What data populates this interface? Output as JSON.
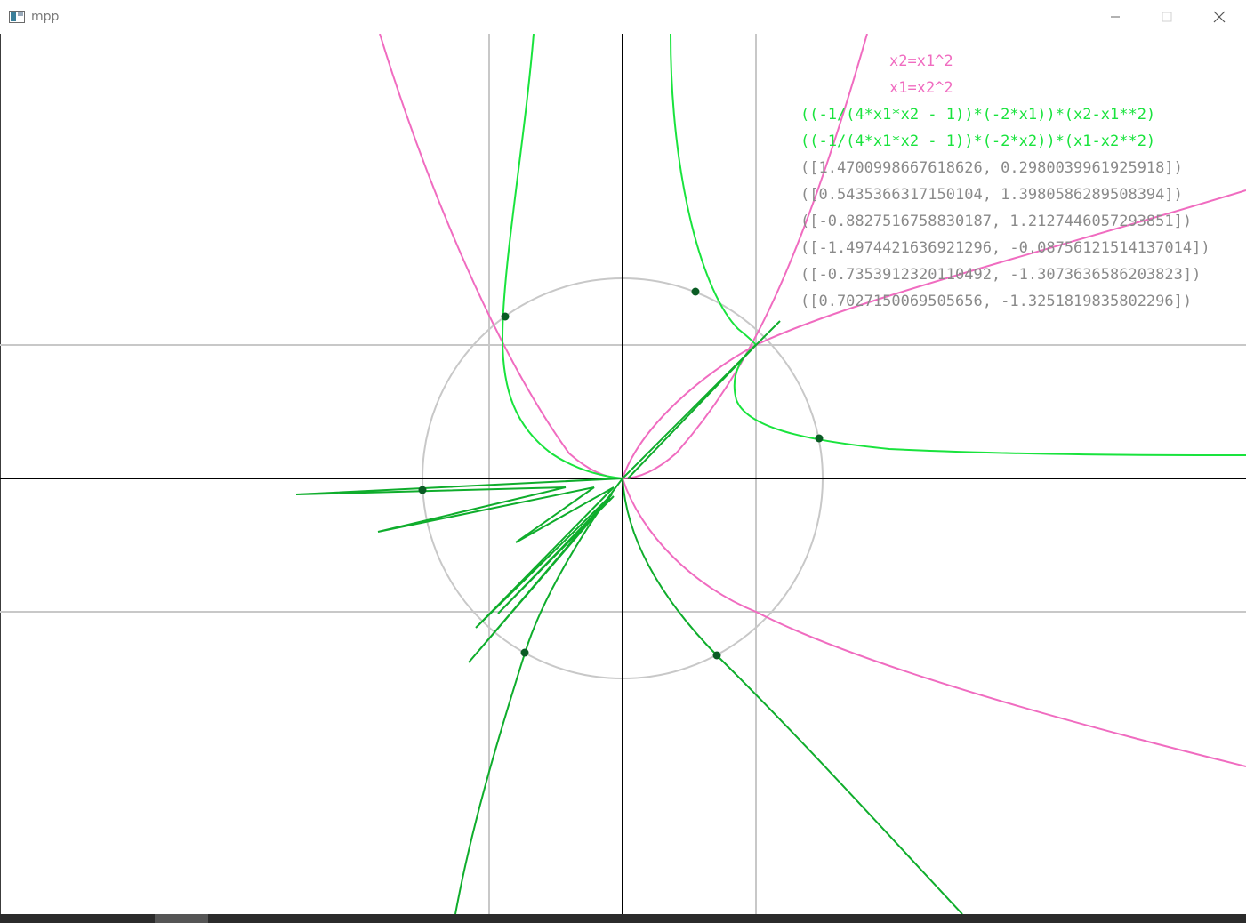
{
  "window": {
    "title": "mpp",
    "icon": "app-window-icon",
    "controls": {
      "minimize_icon": "minimize-icon",
      "maximize_icon": "maximize-icon",
      "close_icon": "close-icon"
    }
  },
  "legend": {
    "curve1": "x2=x1^2",
    "curve2": "x1=x2^2",
    "newton1": "((-1/(4*x1*x2 - 1))*(-2*x1))*(x2-x1**2)",
    "newton2": "((-1/(4*x1*x2 - 1))*(-2*x2))*(x1-x2**2)",
    "points": [
      "([1.4700998667618626, 0.2980039961925918])",
      "([0.5435366317150104, 1.3980586289508394])",
      "([-0.8827516758830187, 1.2127446057293851])",
      "([-1.4974421636921296, -0.08756121514137014])",
      "([-0.7353912320110492, -1.3073636586203823])",
      "([0.7027150069505656, -1.3251819835802296])"
    ]
  },
  "colors": {
    "pink": "#f06cc0",
    "light_green": "#19e33d",
    "dark_green": "#0fad2c",
    "point": "#0a5c24",
    "grid": "#c8c8c8",
    "axis": "#000000",
    "text_gray": "#8a8a8a"
  },
  "chart_data": {
    "type": "line",
    "x_grid": [
      -1,
      0,
      1
    ],
    "y_grid": [
      -1,
      0,
      1
    ],
    "circle_radius": 1.5,
    "curves": [
      {
        "name": "x2=x1^2",
        "kind": "parabola"
      },
      {
        "name": "x1=x2^2",
        "kind": "parabola"
      }
    ],
    "points": [
      [
        1.4700998667618626,
        0.2980039961925918
      ],
      [
        0.5435366317150104,
        1.3980586289508394
      ],
      [
        -0.8827516758830187,
        1.2127446057293851
      ],
      [
        -1.4974421636921296,
        -0.08756121514137014
      ],
      [
        -0.7353912320110492,
        -1.3073636586203823
      ],
      [
        0.7027150069505655,
        -1.3251819835802296
      ]
    ]
  }
}
